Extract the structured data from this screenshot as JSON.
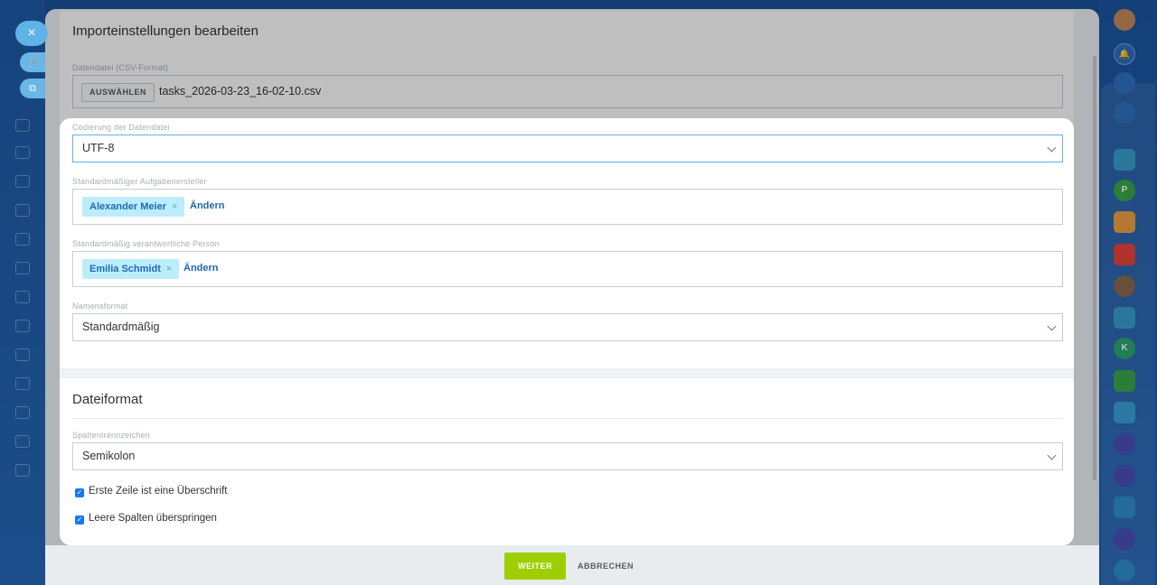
{
  "slider": {
    "title": "Importeinstellungen bearbeiten"
  },
  "file": {
    "label": "Datendatei (CSV-Format)",
    "choose_label": "AUSWÄHLEN",
    "file_name": "tasks_2026-03-23_16-02-10.csv"
  },
  "encoding": {
    "label": "Codierung der Datendatei",
    "value": "UTF-8"
  },
  "creator": {
    "label": "Standardmäßiger Aufgabenersteller",
    "user": "Alexander Meier",
    "remove": "×",
    "change": "Ändern"
  },
  "responsible": {
    "label": "Standardmäßig verantwortliche Person",
    "user": "Emilia Schmidt",
    "remove": "×",
    "change": "Ändern"
  },
  "name_format": {
    "label": "Namensformat",
    "value": "Standardmäßig"
  },
  "file_format": {
    "title": "Dateiformat",
    "separator_label": "Spaltentrennzeichen",
    "separator_value": "Semikolon",
    "first_row_header": "Erste Zeile ist eine Überschrift",
    "skip_empty": "Leere Spalten überspringen",
    "first_row_header_checked": true,
    "skip_empty_checked": true
  },
  "footer": {
    "next_label": "WEITER",
    "cancel_label": "ABBRECHEN"
  },
  "nav": {
    "close_icon": "×",
    "accent": "#9dcf00",
    "link_color": "#2067b0",
    "right_bar_letters": [
      "P",
      "K"
    ]
  }
}
